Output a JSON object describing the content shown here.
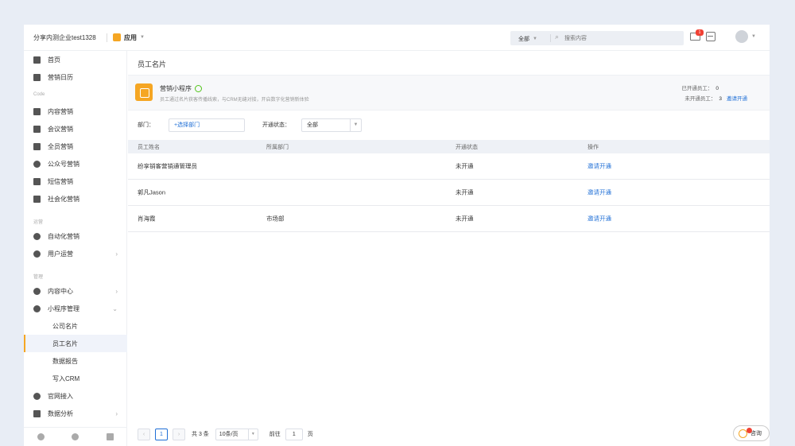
{
  "header": {
    "company": "分享内测企业test1328",
    "app_menu": "应用",
    "search_scope": "全部",
    "search_placeholder": "搜索内容",
    "mail_badge": "1"
  },
  "sidebar": {
    "top_items": [
      {
        "label": "首页",
        "icon": "home-icon"
      },
      {
        "label": "营销日历",
        "icon": "calendar-icon"
      }
    ],
    "section1": "Code",
    "content_items": [
      {
        "label": "内容营销",
        "icon": "document-icon"
      },
      {
        "label": "会议营销",
        "icon": "meeting-icon"
      },
      {
        "label": "全员营销",
        "icon": "team-icon"
      },
      {
        "label": "公众号营销",
        "icon": "wechat-icon"
      },
      {
        "label": "短信营销",
        "icon": "sms-icon"
      },
      {
        "label": "社会化营销",
        "icon": "social-icon"
      }
    ],
    "section2": "运营",
    "ops_items": [
      {
        "label": "自动化营销",
        "icon": "automation-icon"
      },
      {
        "label": "用户运营",
        "icon": "user-icon"
      }
    ],
    "section3": "管理",
    "manage_items": [
      {
        "label": "内容中心",
        "icon": "content-center-icon"
      },
      {
        "label": "小程序管理",
        "icon": "miniprogram-icon"
      }
    ],
    "sub_items": [
      "公司名片",
      "员工名片",
      "数据报告",
      "写入CRM"
    ],
    "bottom_items": [
      {
        "label": "官网接入",
        "icon": "website-icon"
      },
      {
        "label": "数据分析",
        "icon": "analytics-icon"
      }
    ]
  },
  "main": {
    "title": "员工名片",
    "miniprogram": {
      "name": "营销小程序",
      "desc": "员工通过名片获客传播线索，与CRM无缝对接，开启数字化营销新体验"
    },
    "stats": {
      "opened_label": "已开通员工：",
      "opened_value": "0",
      "unopened_label": "未开通员工：",
      "unopened_value": "3",
      "invite_all": "邀请开通"
    },
    "filters": {
      "dept_label": "部门：",
      "dept_value": "+选择部门",
      "status_label": "开通状态：",
      "status_value": "全部"
    },
    "table": {
      "headers": [
        "员工姓名",
        "所属部门",
        "开通状态",
        "操作"
      ],
      "rows": [
        {
          "name": "纷享销客营销通管理员",
          "dept": "",
          "status": "未开通",
          "action": "邀请开通"
        },
        {
          "name": "郭凡Jason",
          "dept": "",
          "status": "未开通",
          "action": "邀请开通"
        },
        {
          "name": "肖海霞",
          "dept": "市场部",
          "status": "未开通",
          "action": "邀请开通"
        }
      ]
    },
    "pager": {
      "current": "1",
      "total": "共 3 条",
      "page_size": "10条/页",
      "goto_label": "前往",
      "goto_value": "1",
      "page_unit": "页"
    }
  },
  "help": {
    "label": "咨询"
  }
}
